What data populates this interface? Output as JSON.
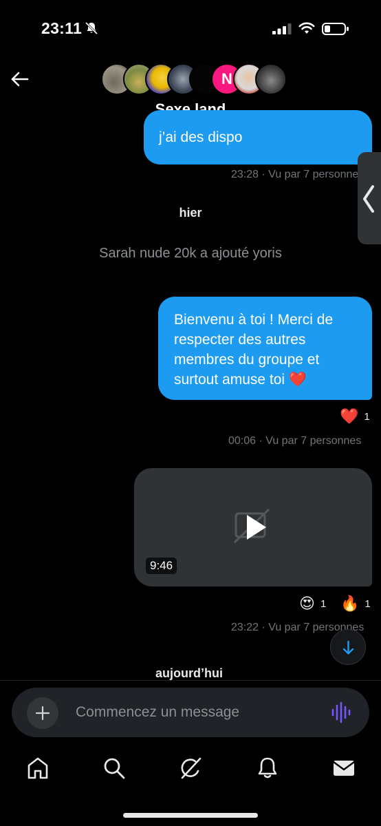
{
  "status_bar": {
    "time": "23:11",
    "icons": [
      "bell-muted-icon",
      "signal-icon",
      "wifi-icon",
      "battery-icon"
    ]
  },
  "header": {
    "group_name": "Sexe land",
    "avatar_initial": "N",
    "icons": [
      "back-arrow-icon"
    ]
  },
  "messages": [
    {
      "type": "sent",
      "text": "j’ai des dispo",
      "meta": "23:28 · Vu par 7 personnes"
    },
    {
      "type": "day_separator",
      "label": "hier"
    },
    {
      "type": "system",
      "text": "Sarah nude 20k a ajouté yoris"
    },
    {
      "type": "sent",
      "text": "Bienvenu à toi ! Merci de respecter des autres membres du groupe et surtout amuse toi ❤️",
      "reactions": [
        {
          "emoji": "❤️",
          "count": "1"
        }
      ],
      "meta": "00:06 · Vu par 7 personnes"
    },
    {
      "type": "video",
      "duration": "9:46",
      "reactions": [
        {
          "emoji": "😍",
          "count": "1"
        },
        {
          "emoji": "🔥",
          "count": "1"
        }
      ],
      "meta": "23:22 · Vu par 7 personnes"
    },
    {
      "type": "day_separator",
      "label": "aujourd’hui"
    }
  ],
  "composer": {
    "placeholder": "Commencez un message"
  },
  "tab_bar": {
    "tabs": [
      "home-icon",
      "search-icon",
      "grok-icon",
      "notifications-icon",
      "messages-icon"
    ]
  },
  "colors": {
    "accent": "#1d9bf0",
    "background": "#000000",
    "muted_text": "#71767b",
    "voice": "#7856ff"
  }
}
